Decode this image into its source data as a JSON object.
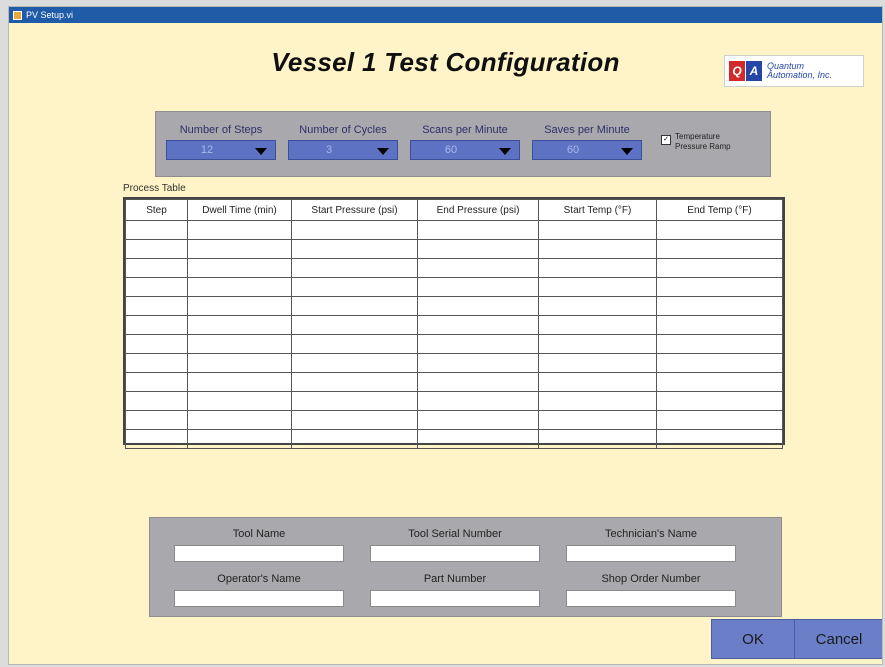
{
  "window": {
    "title": "PV Setup.vi"
  },
  "heading": "Vessel 1 Test Configuration",
  "logo": {
    "mark": [
      "Q",
      "A"
    ],
    "line1": "Quantum",
    "line2": "Automation, Inc."
  },
  "settings": {
    "dropdowns": [
      {
        "label": "Number of Steps",
        "value": "12"
      },
      {
        "label": "Number of Cycles",
        "value": "3"
      },
      {
        "label": "Scans per Minute",
        "value": "60"
      },
      {
        "label": "Saves per Minute",
        "value": "60"
      }
    ],
    "temperature_ramp": {
      "checked": true,
      "label_line1": "Temperature",
      "label_line2": "Pressure Ramp"
    }
  },
  "process_table": {
    "label": "Process Table",
    "columns": [
      "Step",
      "Dwell Time (min)",
      "Start Pressure (psi)",
      "End Pressure (psi)",
      "Start Temp (°F)",
      "End Temp (°F)"
    ],
    "row_count": 12
  },
  "info_fields": [
    {
      "label": "Tool Name",
      "value": ""
    },
    {
      "label": "Tool Serial Number",
      "value": ""
    },
    {
      "label": "Technician's Name",
      "value": ""
    },
    {
      "label": "Operator's Name",
      "value": ""
    },
    {
      "label": "Part Number",
      "value": ""
    },
    {
      "label": "Shop Order Number",
      "value": ""
    }
  ],
  "buttons": {
    "ok": "OK",
    "cancel": "Cancel"
  },
  "colors": {
    "background": "#fff4c8",
    "panel": "#a9a9ad",
    "dropdown": "#5d72c3",
    "button": "#6b7ec8",
    "titlebar": "#1f5ba7"
  }
}
